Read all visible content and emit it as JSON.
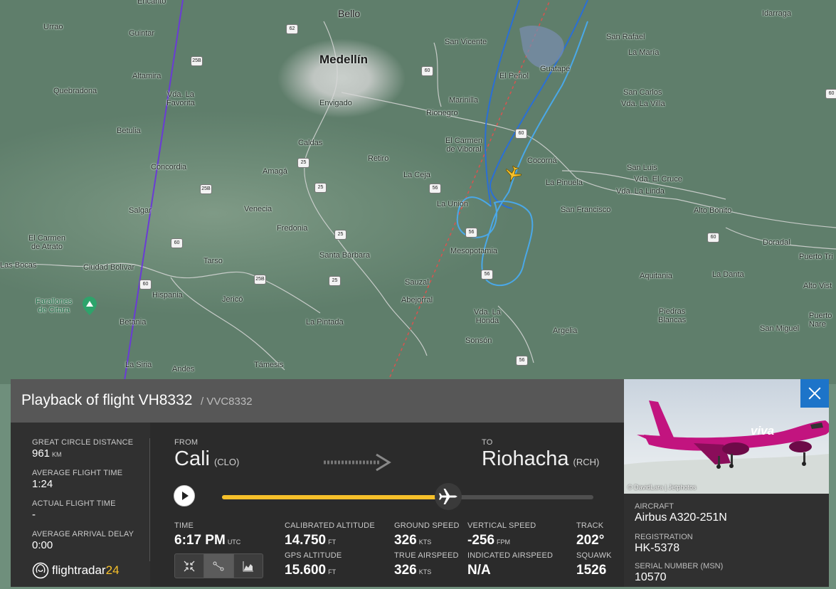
{
  "map": {
    "places": [
      {
        "name": "Encanto"
      },
      {
        "name": "Bello"
      },
      {
        "name": "Medellín"
      },
      {
        "name": "Urrao"
      },
      {
        "name": "Guintar"
      },
      {
        "name": "Altamira"
      },
      {
        "name": "Vda. La\nFavorita"
      },
      {
        "name": "Quebradona"
      },
      {
        "name": "Betulia"
      },
      {
        "name": "Concordia"
      },
      {
        "name": "Salgar"
      },
      {
        "name": "El Carmen\nde Atrato"
      },
      {
        "name": "Las Bocas"
      },
      {
        "name": "Ciudad Bolívar"
      },
      {
        "name": "Farallones\nde Citara"
      },
      {
        "name": "Hispania"
      },
      {
        "name": "Betania"
      },
      {
        "name": "La Siria"
      },
      {
        "name": "Andes"
      },
      {
        "name": "Jericó"
      },
      {
        "name": "Tarso"
      },
      {
        "name": "Venecia"
      },
      {
        "name": "Fredonia"
      },
      {
        "name": "Amagá"
      },
      {
        "name": "Caldas"
      },
      {
        "name": "Envigado"
      },
      {
        "name": "Retiro"
      },
      {
        "name": "La Ceja"
      },
      {
        "name": "Rionegro"
      },
      {
        "name": "Marinilla"
      },
      {
        "name": "El Carmen\nde Viboral"
      },
      {
        "name": "San Vicente"
      },
      {
        "name": "El Peñol"
      },
      {
        "name": "Guatapé"
      },
      {
        "name": "Cocorná"
      },
      {
        "name": "La Pinuela"
      },
      {
        "name": "La Unión"
      },
      {
        "name": "Mesopotamia"
      },
      {
        "name": "San Francisco"
      },
      {
        "name": "Santa Bárbara"
      },
      {
        "name": "Sauzal"
      },
      {
        "name": "Abejorral"
      },
      {
        "name": "Vda. La\nHonda"
      },
      {
        "name": "La Pintada"
      },
      {
        "name": "Támesis"
      },
      {
        "name": "Sonsón"
      },
      {
        "name": "Argelia"
      },
      {
        "name": "Piedras\nBlancas"
      },
      {
        "name": "Aquitania"
      },
      {
        "name": "La Danta"
      },
      {
        "name": "San Miguel"
      },
      {
        "name": "Puerto\nNare"
      },
      {
        "name": "Alto Vist"
      },
      {
        "name": "Puerto Tri"
      },
      {
        "name": "Doradal"
      },
      {
        "name": "Alto Bonito"
      },
      {
        "name": "San Luis"
      },
      {
        "name": "Vda. El Cruce"
      },
      {
        "name": "Vda. La Linda"
      },
      {
        "name": "San Carlos"
      },
      {
        "name": "Vda. La Villa"
      },
      {
        "name": "La María"
      },
      {
        "name": "San Rafael"
      },
      {
        "name": "Idarraga"
      }
    ],
    "road_shields": [
      "62",
      "25B",
      "60",
      "25",
      "25B",
      "60",
      "56",
      "25",
      "25",
      "25B",
      "56",
      "56",
      "25",
      "56",
      "60",
      "60",
      "60",
      "60"
    ]
  },
  "panel": {
    "title": "Playback of flight VH8332",
    "subtitle": "/ VVC8332",
    "stats": {
      "gcd_label": "GREAT CIRCLE DISTANCE",
      "gcd_value": "961",
      "gcd_unit": "KM",
      "aft_label": "AVERAGE FLIGHT TIME",
      "aft_value": "1:24",
      "act_label": "ACTUAL FLIGHT TIME",
      "act_value": "-",
      "aad_label": "AVERAGE ARRIVAL DELAY",
      "aad_value": "0:00"
    },
    "from_label": "FROM",
    "from_city": "Cali",
    "from_code": "(CLO)",
    "to_label": "TO",
    "to_city": "Riohacha",
    "to_code": "(RCH)",
    "progress": 0.6,
    "readouts": {
      "time_label": "TIME",
      "time_value": "6:17 PM",
      "time_unit": "UTC",
      "cal_alt_label": "CALIBRATED ALTITUDE",
      "cal_alt_value": "14.750",
      "cal_alt_unit": "FT",
      "gps_alt_label": "GPS ALTITUDE",
      "gps_alt_value": "15.600",
      "gps_alt_unit": "FT",
      "gs_label": "GROUND SPEED",
      "gs_value": "326",
      "gs_unit": "KTS",
      "tas_label": "TRUE AIRSPEED",
      "tas_value": "326",
      "tas_unit": "KTS",
      "vs_label": "VERTICAL SPEED",
      "vs_value": "-256",
      "vs_unit": "FPM",
      "ias_label": "INDICATED AIRSPEED",
      "ias_value": "N/A",
      "track_label": "TRACK",
      "track_value": "202°",
      "squawk_label": "SQUAWK",
      "squawk_value": "1526"
    },
    "logo_text": "flightradar",
    "logo_num": "24"
  },
  "aircraft": {
    "photo_credit": "© DavidLara | Jetphotos",
    "type_label": "AIRCRAFT",
    "type_value": "Airbus A320-251N",
    "reg_label": "REGISTRATION",
    "reg_value": "HK-5378",
    "msn_label": "SERIAL NUMBER (MSN)",
    "msn_value": "10570",
    "livery_text": "viva"
  },
  "colors": {
    "progress": "#f6c02a",
    "close_button": "#1d74c9",
    "track_light": "#4aa8e8",
    "track_dark": "#2a6fd6",
    "other_flight": "#6a3bd6",
    "route_line": "#d9534f"
  }
}
